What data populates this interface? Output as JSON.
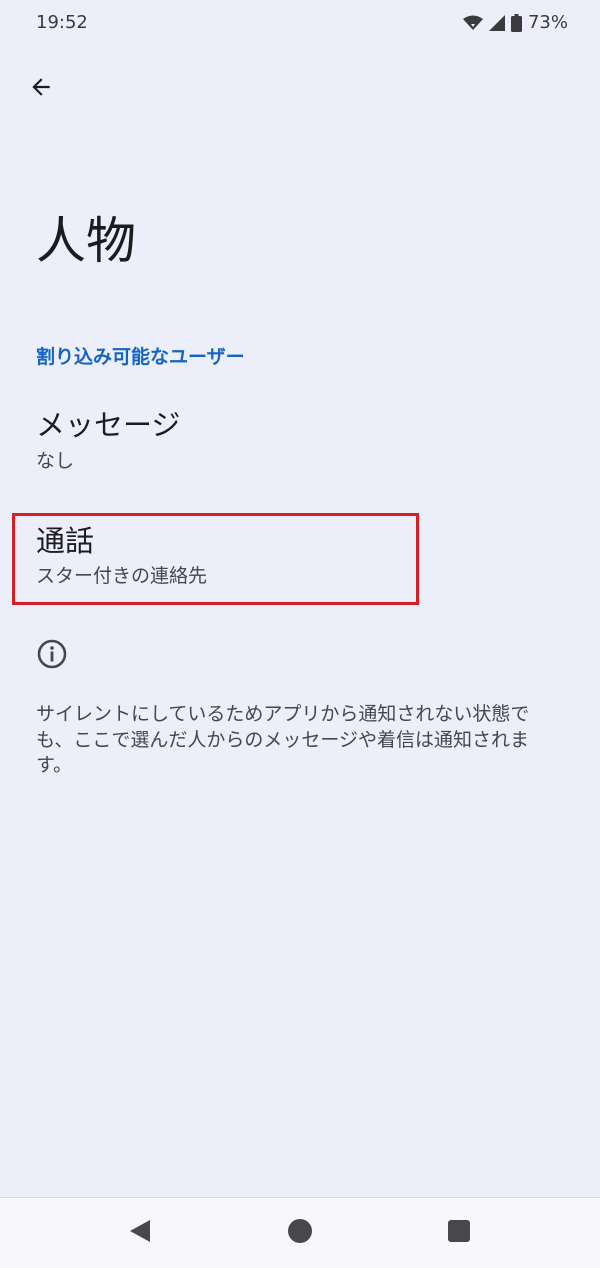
{
  "status_bar": {
    "time": "19:52",
    "battery": "73%",
    "icons": [
      "wifi-icon",
      "signal-icon",
      "battery-icon"
    ]
  },
  "toolbar": {
    "back_icon": "arrow-left-icon"
  },
  "page": {
    "title": "人物"
  },
  "section": {
    "header": "割り込み可能なユーザー"
  },
  "items": [
    {
      "title": "メッセージ",
      "summary": "なし"
    },
    {
      "title": "通話",
      "summary": "スター付きの連絡先"
    }
  ],
  "info": {
    "icon": "info-icon",
    "text": "サイレントにしているためアプリから通知されない状態でも、ここで選んだ人からのメッセージや着信は通知されます。"
  },
  "nav": {
    "buttons": [
      "back-icon",
      "home-icon",
      "recents-icon"
    ]
  },
  "colors": {
    "background": "#eceefa",
    "accent": "#1565c0",
    "highlight": "#d61f26"
  }
}
